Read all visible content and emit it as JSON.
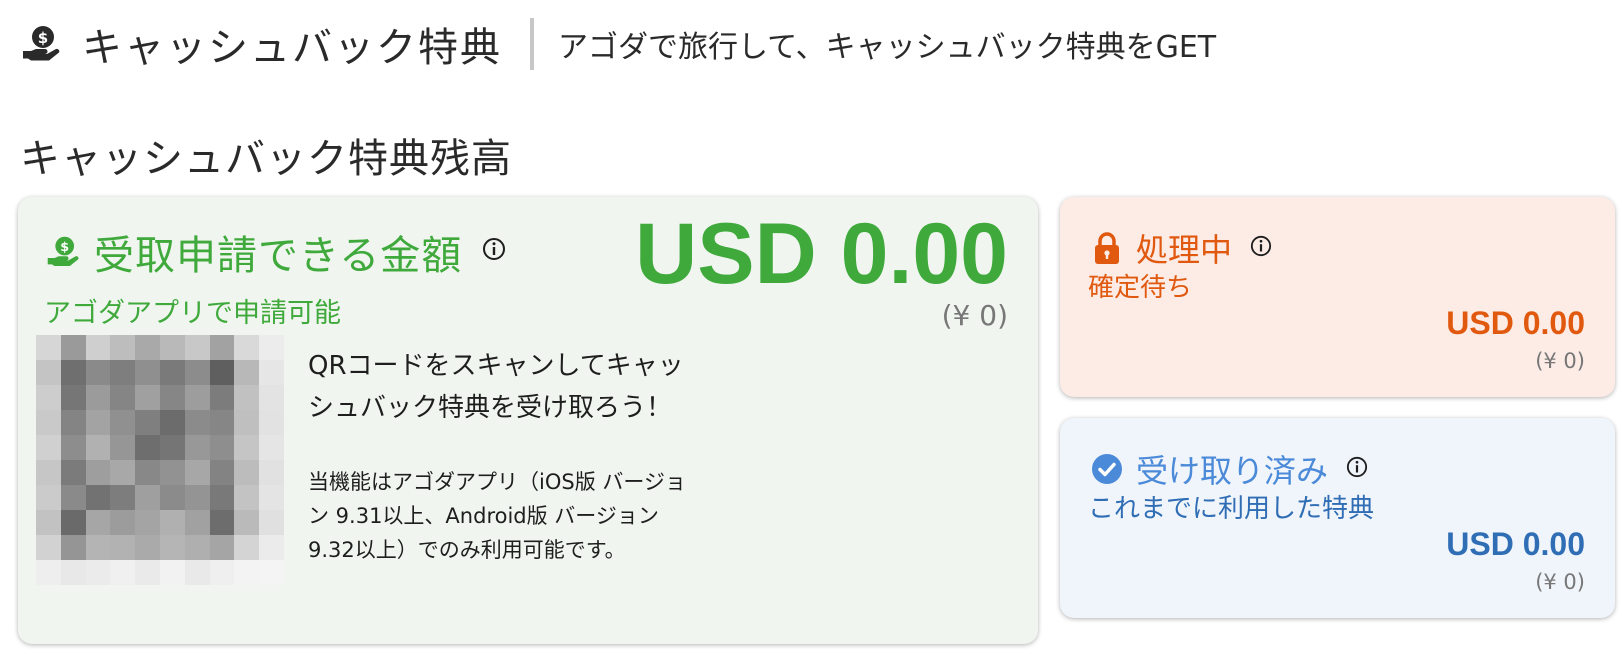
{
  "header": {
    "title": "キャッシュバック特典",
    "subtitle": "アゴダで旅行して、キャッシュバック特典をGET"
  },
  "section": {
    "title": "キャッシュバック特典残高"
  },
  "available": {
    "title": "受取申請できる金額",
    "amount": "USD 0.00",
    "yen": "(¥ 0)",
    "subtitle": "アゴダアプリで申請可能",
    "qr_text": "QRコードをスキャンしてキャッシュバック特典を受け取ろう！",
    "qr_note": "当機能はアゴダアプリ（iOS版 バージョン 9.31以上、Android版 バージョン 9.32以上）でのみ利用可能です。",
    "color": "#3fa93c"
  },
  "processing": {
    "title": "処理中",
    "subtitle": "確定待ち",
    "amount": "USD 0.00",
    "yen": "(¥ 0)",
    "color": "#e0590f"
  },
  "received": {
    "title": "受け取り済み",
    "subtitle": "これまでに利用した特典",
    "amount": "USD 0.00",
    "yen": "(¥ 0)",
    "color": "#2f6db5"
  },
  "icons": {
    "header": "cashback-hand-icon",
    "available": "cashback-hand-icon",
    "info": "info-icon",
    "processing": "lock-icon",
    "received": "check-circle-icon",
    "qr": "qr-code-blurred"
  }
}
